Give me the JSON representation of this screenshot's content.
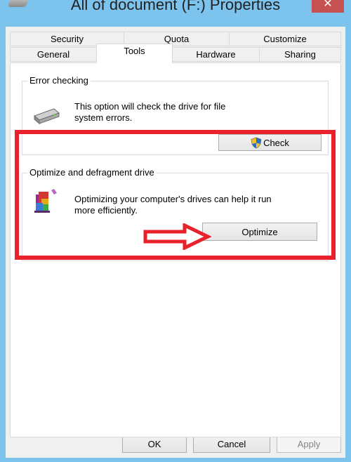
{
  "window": {
    "title": "All of document (F:) Properties",
    "close_label": "✕"
  },
  "tabs": {
    "row_top": [
      "Security",
      "Quota",
      "Customize"
    ],
    "row_bottom": [
      "General",
      "Tools",
      "Hardware",
      "Sharing"
    ],
    "active": "Tools"
  },
  "error_checking": {
    "legend": "Error checking",
    "description_line1": "This option will check the drive for file",
    "description_line2": "system errors.",
    "button_label": "Check"
  },
  "optimize": {
    "legend": "Optimize and defragment drive",
    "description_line1": "Optimizing your computer's drives can help it run",
    "description_line2": "more efficiently.",
    "button_label": "Optimize"
  },
  "footer": {
    "ok_label": "OK",
    "cancel_label": "Cancel",
    "apply_label": "Apply"
  },
  "colors": {
    "titlebar": "#7cc3ed",
    "annotation_red": "#e8212a"
  },
  "icons": {
    "drive": "hard-drive-icon",
    "defrag": "defrag-icon",
    "shield": "uac-shield-icon"
  }
}
